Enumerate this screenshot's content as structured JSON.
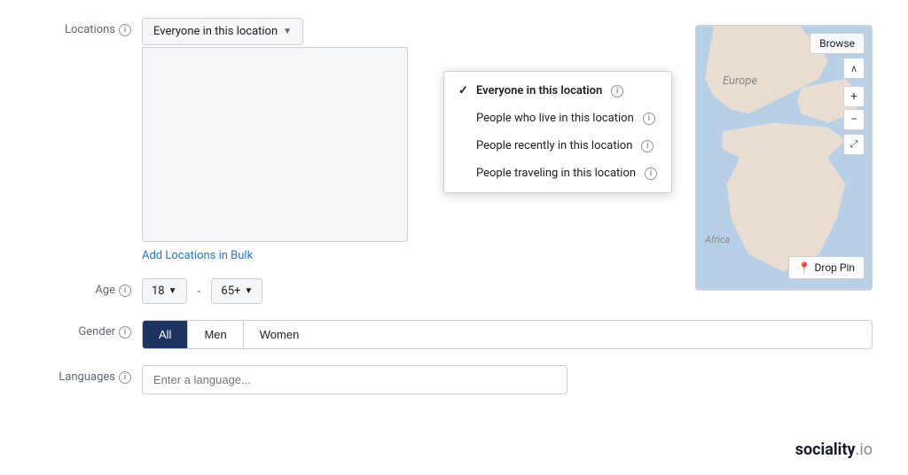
{
  "form": {
    "locations_label": "Locations",
    "age_label": "Age",
    "gender_label": "Gender",
    "languages_label": "Languages"
  },
  "dropdown": {
    "button_label": "Everyone in this location",
    "items": [
      {
        "label": "Everyone in this location",
        "selected": true,
        "info": true
      },
      {
        "label": "People who live in this location",
        "selected": false,
        "info": true
      },
      {
        "label": "People recently in this location",
        "selected": false,
        "info": true
      },
      {
        "label": "People traveling in this location",
        "selected": false,
        "info": true
      }
    ]
  },
  "map": {
    "browse_label": "Browse",
    "drop_pin_label": "Drop Pin",
    "europe_label": "Europe",
    "africa_label": "Africa"
  },
  "add_locations": "Add Locations in Bulk",
  "age": {
    "min": "18",
    "max": "65+",
    "separator": "-"
  },
  "gender": {
    "options": [
      "All",
      "Men",
      "Women"
    ],
    "active": "All"
  },
  "language": {
    "placeholder": "Enter a language..."
  },
  "logo": {
    "text": "sociality",
    "tld": ".io"
  }
}
